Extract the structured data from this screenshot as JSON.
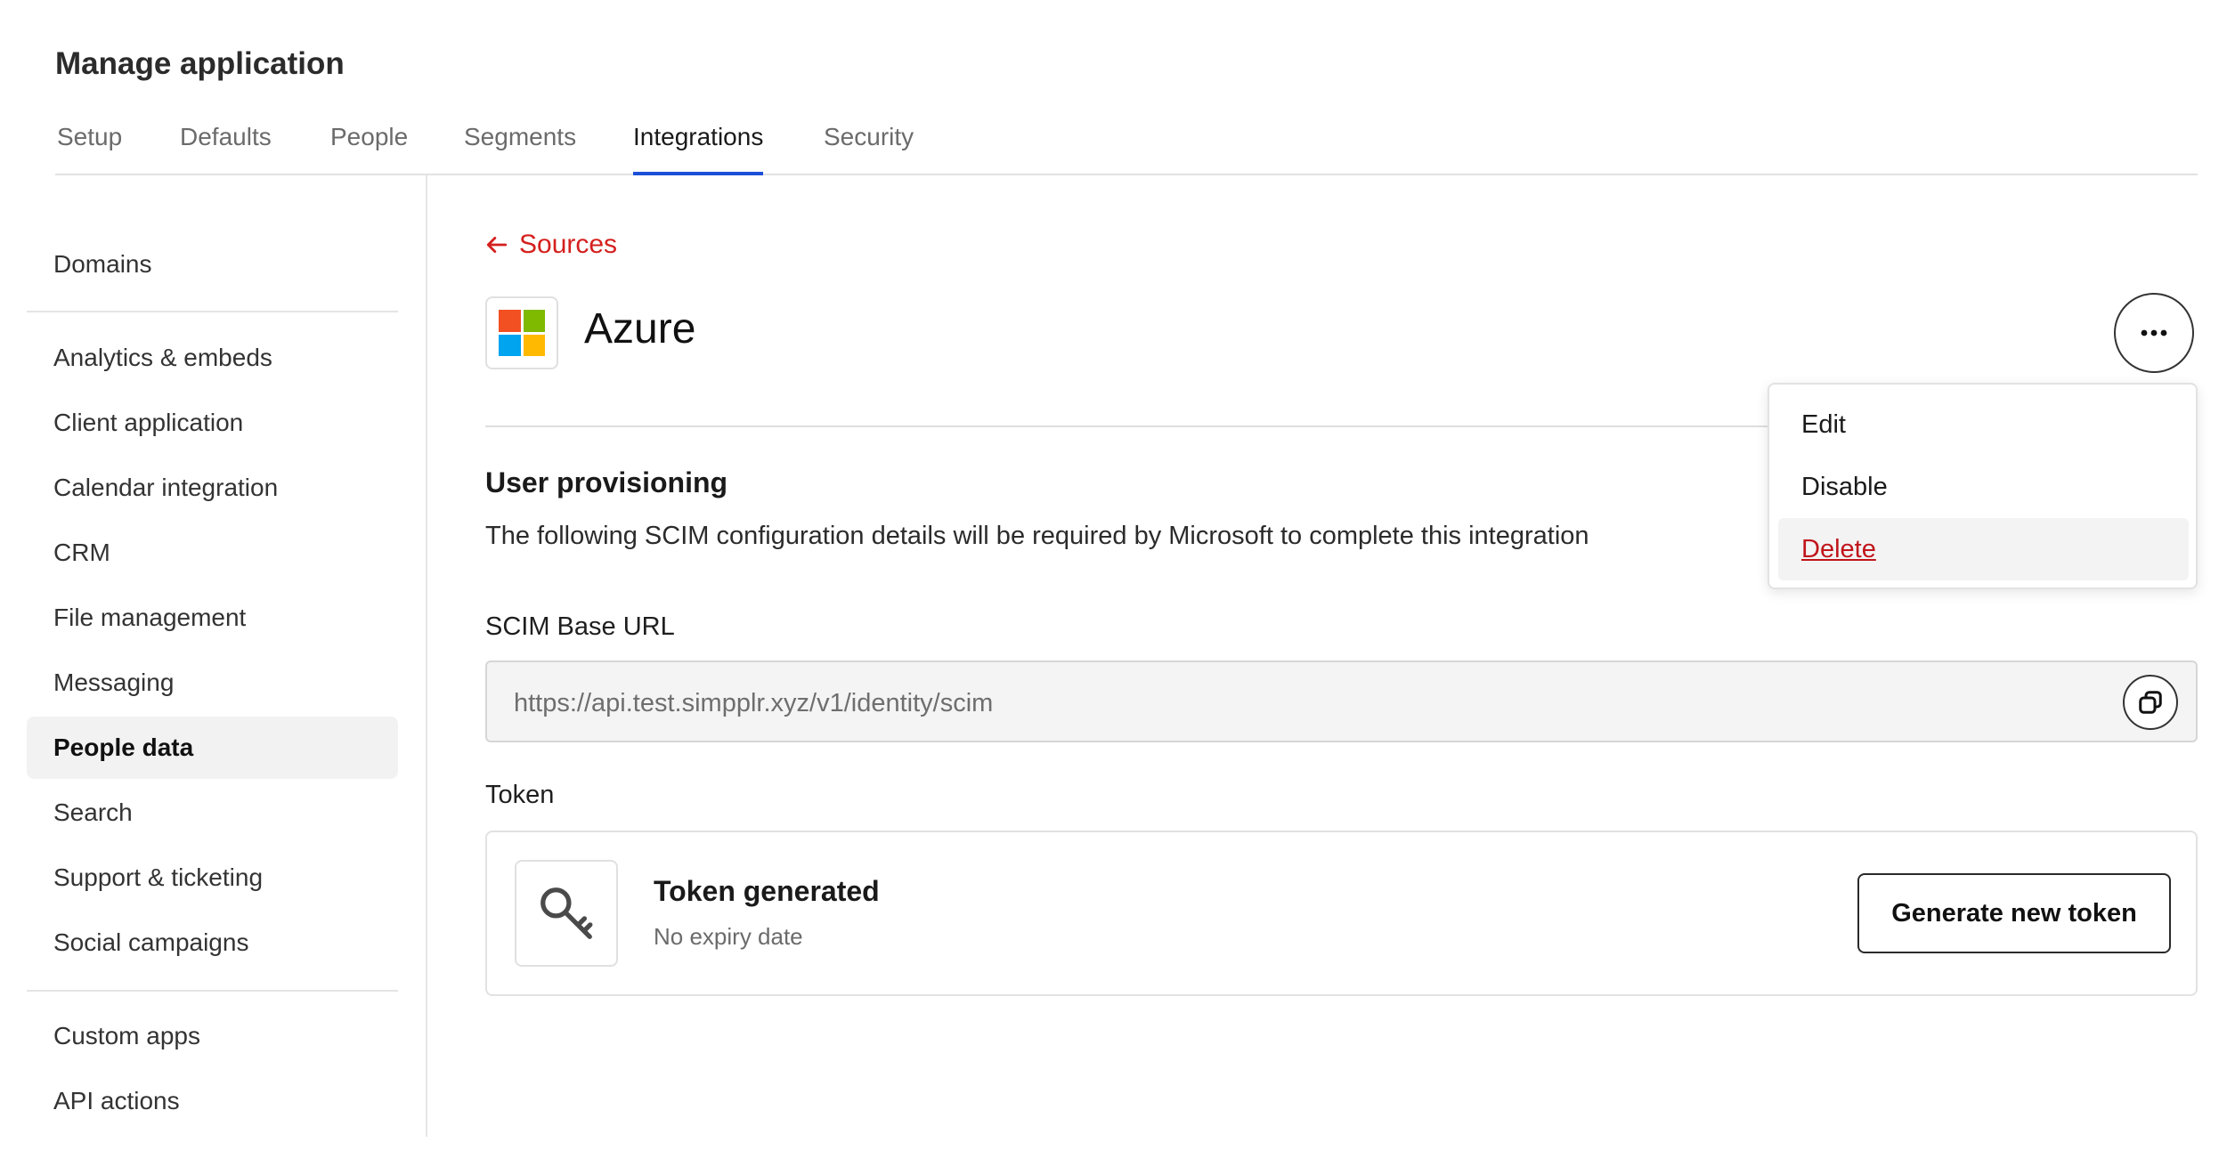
{
  "header": {
    "title": "Manage application"
  },
  "tabs": [
    {
      "label": "Setup"
    },
    {
      "label": "Defaults"
    },
    {
      "label": "People"
    },
    {
      "label": "Segments"
    },
    {
      "label": "Integrations",
      "active": true
    },
    {
      "label": "Security"
    }
  ],
  "sidebar": {
    "items": [
      {
        "label": "Domains"
      },
      {
        "label": "Analytics & embeds"
      },
      {
        "label": "Client application"
      },
      {
        "label": "Calendar integration"
      },
      {
        "label": "CRM"
      },
      {
        "label": "File management"
      },
      {
        "label": "Messaging"
      },
      {
        "label": "People data",
        "active": true
      },
      {
        "label": "Search"
      },
      {
        "label": "Support & ticketing"
      },
      {
        "label": "Social campaigns"
      },
      {
        "label": "Custom apps"
      },
      {
        "label": "API actions"
      }
    ]
  },
  "main": {
    "back_link": "Sources",
    "app_name": "Azure",
    "section_title": "User provisioning",
    "section_description": "The following SCIM configuration details will be required by Microsoft to complete this integration",
    "scim_label": "SCIM Base URL",
    "scim_url": "https://api.test.simpplr.xyz/v1/identity/scim",
    "token_label": "Token",
    "token_title": "Token generated",
    "token_subtitle": "No expiry date",
    "generate_button": "Generate new token"
  },
  "menu": {
    "items": [
      {
        "label": "Edit"
      },
      {
        "label": "Disable"
      },
      {
        "label": "Delete",
        "danger": true,
        "hovered": true
      }
    ]
  },
  "colors": {
    "accent_tab": "#1b4fd8",
    "link_red": "#d4201e",
    "danger": "#c0141a",
    "ms_red": "#f25022",
    "ms_green": "#7fba00",
    "ms_blue": "#00a4ef",
    "ms_yellow": "#ffb900"
  },
  "icons": {
    "back": "arrow-left-icon",
    "more": "more-horizontal-icon",
    "copy": "copy-icon",
    "key": "key-icon",
    "logo": "microsoft-logo"
  }
}
